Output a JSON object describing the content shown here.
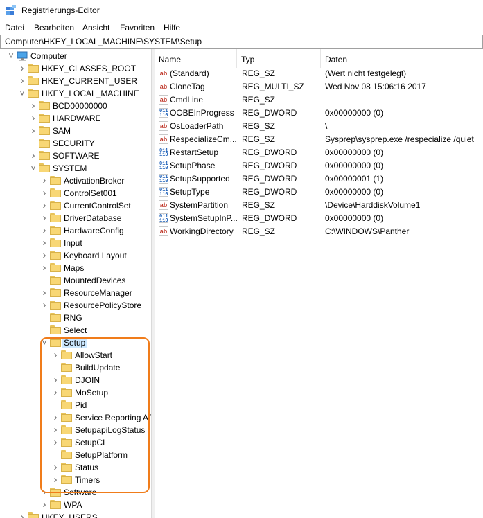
{
  "window": {
    "title": "Registrierungs-Editor"
  },
  "menu": [
    "Datei",
    "Bearbeiten",
    "Ansicht",
    "Favoriten",
    "Hilfe"
  ],
  "address": "Computer\\HKEY_LOCAL_MACHINE\\SYSTEM\\Setup",
  "tree": [
    {
      "label": "Computer",
      "level": 0,
      "chevron": "expanded",
      "icon": "computer-icon"
    },
    {
      "label": "HKEY_CLASSES_ROOT",
      "level": 1,
      "chevron": "collapsed"
    },
    {
      "label": "HKEY_CURRENT_USER",
      "level": 1,
      "chevron": "collapsed"
    },
    {
      "label": "HKEY_LOCAL_MACHINE",
      "level": 1,
      "chevron": "expanded"
    },
    {
      "label": "BCD00000000",
      "level": 2,
      "chevron": "collapsed"
    },
    {
      "label": "HARDWARE",
      "level": 2,
      "chevron": "collapsed"
    },
    {
      "label": "SAM",
      "level": 2,
      "chevron": "collapsed"
    },
    {
      "label": "SECURITY",
      "level": 2,
      "chevron": "none"
    },
    {
      "label": "SOFTWARE",
      "level": 2,
      "chevron": "collapsed"
    },
    {
      "label": "SYSTEM",
      "level": 2,
      "chevron": "expanded"
    },
    {
      "label": "ActivationBroker",
      "level": 3,
      "chevron": "collapsed"
    },
    {
      "label": "ControlSet001",
      "level": 3,
      "chevron": "collapsed"
    },
    {
      "label": "CurrentControlSet",
      "level": 3,
      "chevron": "collapsed"
    },
    {
      "label": "DriverDatabase",
      "level": 3,
      "chevron": "collapsed"
    },
    {
      "label": "HardwareConfig",
      "level": 3,
      "chevron": "collapsed"
    },
    {
      "label": "Input",
      "level": 3,
      "chevron": "collapsed"
    },
    {
      "label": "Keyboard Layout",
      "level": 3,
      "chevron": "collapsed"
    },
    {
      "label": "Maps",
      "level": 3,
      "chevron": "collapsed"
    },
    {
      "label": "MountedDevices",
      "level": 3,
      "chevron": "none"
    },
    {
      "label": "ResourceManager",
      "level": 3,
      "chevron": "collapsed"
    },
    {
      "label": "ResourcePolicyStore",
      "level": 3,
      "chevron": "collapsed"
    },
    {
      "label": "RNG",
      "level": 3,
      "chevron": "none"
    },
    {
      "label": "Select",
      "level": 3,
      "chevron": "none"
    },
    {
      "label": "Setup",
      "level": 3,
      "chevron": "expanded",
      "selected": true
    },
    {
      "label": "AllowStart",
      "level": 4,
      "chevron": "collapsed"
    },
    {
      "label": "BuildUpdate",
      "level": 4,
      "chevron": "none"
    },
    {
      "label": "DJOIN",
      "level": 4,
      "chevron": "collapsed"
    },
    {
      "label": "MoSetup",
      "level": 4,
      "chevron": "collapsed"
    },
    {
      "label": "Pid",
      "level": 4,
      "chevron": "none"
    },
    {
      "label": "Service Reporting AP",
      "level": 4,
      "chevron": "collapsed"
    },
    {
      "label": "SetupapiLogStatus",
      "level": 4,
      "chevron": "collapsed"
    },
    {
      "label": "SetupCI",
      "level": 4,
      "chevron": "collapsed"
    },
    {
      "label": "SetupPlatform",
      "level": 4,
      "chevron": "none"
    },
    {
      "label": "Status",
      "level": 4,
      "chevron": "collapsed"
    },
    {
      "label": "Timers",
      "level": 4,
      "chevron": "collapsed"
    },
    {
      "label": "Software",
      "level": 3,
      "chevron": "collapsed"
    },
    {
      "label": "WPA",
      "level": 3,
      "chevron": "collapsed"
    },
    {
      "label": "HKEY_USERS",
      "level": 1,
      "chevron": "collapsed"
    }
  ],
  "columns": {
    "name": "Name",
    "type": "Typ",
    "data": "Daten"
  },
  "values": [
    {
      "icon": "string-value-icon",
      "name": "(Standard)",
      "type": "REG_SZ",
      "data": "(Wert nicht festgelegt)"
    },
    {
      "icon": "string-value-icon",
      "name": "CloneTag",
      "type": "REG_MULTI_SZ",
      "data": "Wed Nov 08 15:06:16 2017"
    },
    {
      "icon": "string-value-icon",
      "name": "CmdLine",
      "type": "REG_SZ",
      "data": ""
    },
    {
      "icon": "binary-value-icon",
      "name": "OOBEInProgress",
      "type": "REG_DWORD",
      "data": "0x00000000 (0)"
    },
    {
      "icon": "string-value-icon",
      "name": "OsLoaderPath",
      "type": "REG_SZ",
      "data": "\\"
    },
    {
      "icon": "string-value-icon",
      "name": "RespecializeCm...",
      "type": "REG_SZ",
      "data": "Sysprep\\sysprep.exe /respecialize /quiet"
    },
    {
      "icon": "binary-value-icon",
      "name": "RestartSetup",
      "type": "REG_DWORD",
      "data": "0x00000000 (0)"
    },
    {
      "icon": "binary-value-icon",
      "name": "SetupPhase",
      "type": "REG_DWORD",
      "data": "0x00000000 (0)"
    },
    {
      "icon": "binary-value-icon",
      "name": "SetupSupported",
      "type": "REG_DWORD",
      "data": "0x00000001 (1)"
    },
    {
      "icon": "binary-value-icon",
      "name": "SetupType",
      "type": "REG_DWORD",
      "data": "0x00000000 (0)"
    },
    {
      "icon": "string-value-icon",
      "name": "SystemPartition",
      "type": "REG_SZ",
      "data": "\\Device\\HarddiskVolume1"
    },
    {
      "icon": "binary-value-icon",
      "name": "SystemSetupInP...",
      "type": "REG_DWORD",
      "data": "0x00000000 (0)"
    },
    {
      "icon": "string-value-icon",
      "name": "WorkingDirectory",
      "type": "REG_SZ",
      "data": "C:\\WINDOWS\\Panther"
    }
  ],
  "colors": {
    "highlight": "#f07c1a",
    "selection": "#cce8ff",
    "folder": "#f8d775"
  }
}
